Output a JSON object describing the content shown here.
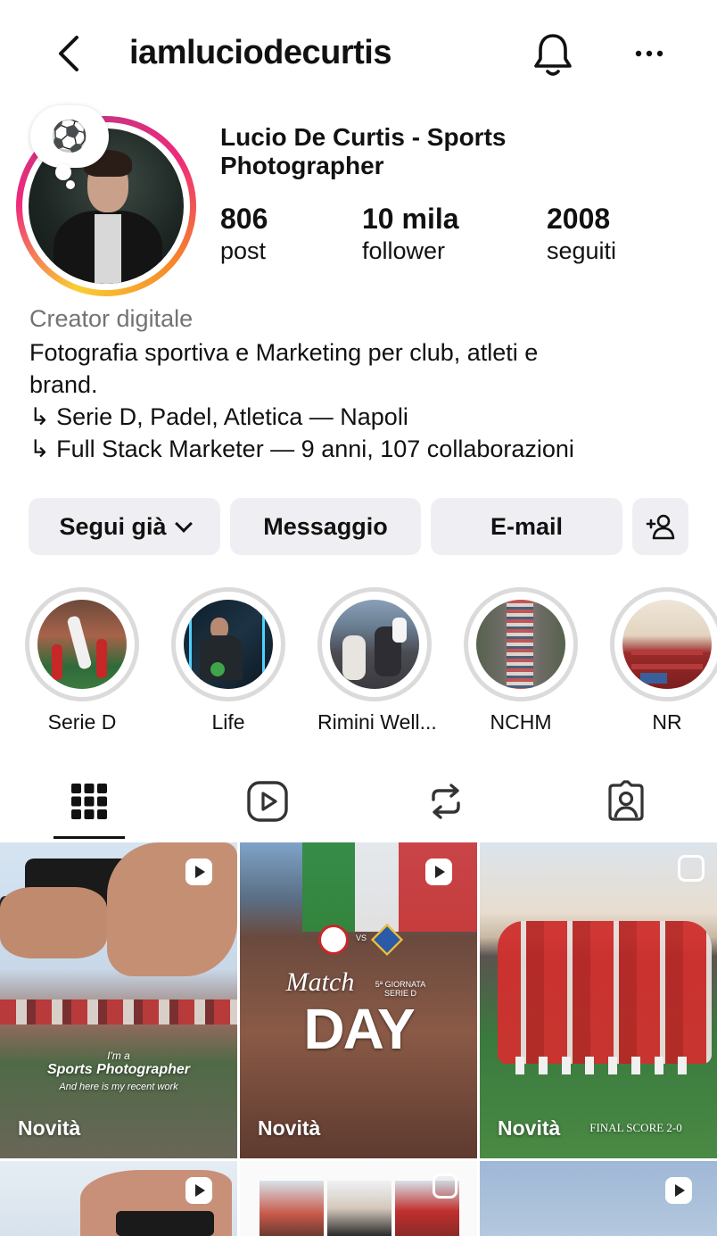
{
  "header": {
    "username": "iamluciodecurtis",
    "back_icon": "chevron-left-icon",
    "bell_icon": "bell-icon",
    "more_icon": "more-horizontal-icon"
  },
  "profile": {
    "note_emoji": "⚽",
    "display_name": "Lucio De Curtis - Sports Photographer",
    "stats": [
      {
        "value": "806",
        "label": "post"
      },
      {
        "value": "10 mila",
        "label": "follower"
      },
      {
        "value": "2008",
        "label": "seguiti"
      }
    ],
    "category": "Creator digitale",
    "bio_lines": [
      "Fotografia sportiva e Marketing per club, atleti e",
      "brand.",
      "↳ Serie D, Padel, Atletica — Napoli",
      "↳ Full Stack Marketer — 9 anni, 107 collaborazioni"
    ]
  },
  "actions": {
    "follow_label": "Segui già",
    "message_label": "Messaggio",
    "email_label": "E-mail",
    "add_user_icon": "add-person-icon"
  },
  "highlights": [
    {
      "label": "Serie D"
    },
    {
      "label": "Life"
    },
    {
      "label": "Rimini Well..."
    },
    {
      "label": "NCHM"
    },
    {
      "label": "NR"
    }
  ],
  "tabs": [
    "grid-icon",
    "reels-icon",
    "reposts-icon",
    "tagged-icon"
  ],
  "grid": {
    "tiles": [
      {
        "label": "Novità",
        "overlay_small": "I'm a",
        "overlay_title": "Sports Photographer",
        "overlay_sub": "And here is my recent work"
      },
      {
        "label": "Novità",
        "overlay_script": "Match",
        "overlay_title": "DAY",
        "overlay_sub": "5ª GIORNATA SERIE D",
        "overlay_vs": "VS"
      },
      {
        "label": "Novità",
        "overlay_sub": "FINAL SCORE 2-0"
      }
    ]
  },
  "colors": {
    "button_bg": "#efeff3",
    "secondary_text": "#737373",
    "story_ring_gradient": [
      "#f9ce34",
      "#ee2a7b",
      "#c13584"
    ]
  }
}
